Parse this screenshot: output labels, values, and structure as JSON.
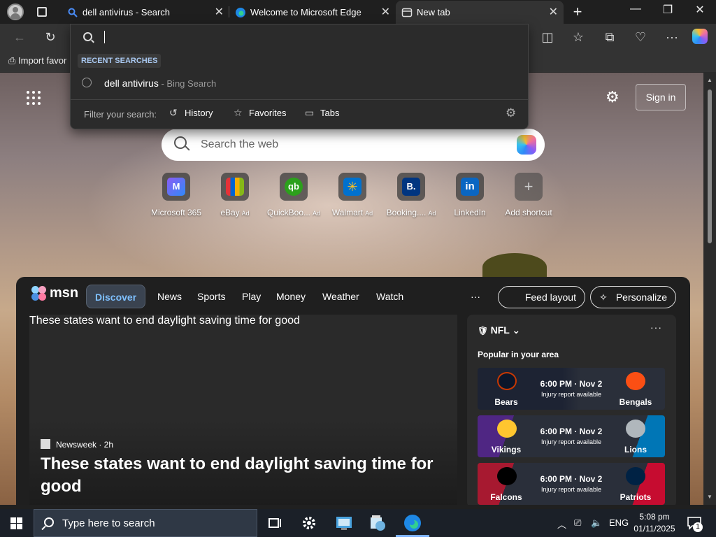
{
  "tabs": [
    {
      "title": "dell antivirus - Search"
    },
    {
      "title": "Welcome to Microsoft Edge"
    },
    {
      "title": "New tab"
    }
  ],
  "window_controls": {
    "new_tab": "+",
    "minimize": "—",
    "maximize": "❐",
    "close": "✕"
  },
  "favorites_bar": {
    "import_label": "Import favor"
  },
  "page": {
    "sign_in": "Sign in",
    "search_placeholder": "Search the web"
  },
  "shortcuts": [
    {
      "label": "Microsoft 365",
      "ad": "",
      "color": "#3a3a5a",
      "glyph": "M"
    },
    {
      "label": "eBay",
      "ad": "Ad",
      "color": "#1f1f1f",
      "glyph": "e"
    },
    {
      "label": "QuickBoo...",
      "ad": "Ad",
      "color": "#2ca01c",
      "glyph": "qb"
    },
    {
      "label": "Walmart",
      "ad": "Ad",
      "color": "#0071ce",
      "glyph": "✳"
    },
    {
      "label": "Booking....",
      "ad": "Ad",
      "color": "#003580",
      "glyph": "B."
    },
    {
      "label": "LinkedIn",
      "ad": "",
      "color": "#0a66c2",
      "glyph": "in"
    },
    {
      "label": "Add shortcut",
      "ad": "",
      "color": "transparent",
      "glyph": "+"
    }
  ],
  "msn": {
    "logo_text": "msn",
    "nav": [
      "Discover",
      "News",
      "Sports",
      "Play",
      "Money",
      "Weather",
      "Watch"
    ],
    "more": "···",
    "feed_layout": "Feed layout",
    "personalize": "Personalize",
    "hero": {
      "image_alt": "These states want to end daylight saving time for good",
      "source": "Newsweek · 2h",
      "headline": "These states want to end daylight saving time for good"
    },
    "sports": {
      "league": "NFL",
      "more": "···",
      "popular": "Popular in your area",
      "games": [
        {
          "home": "Bears",
          "away": "Bengals",
          "time": "6:00 PM · Nov 2",
          "note": "Injury report available",
          "bg": "#1e2436",
          "home_color": "#0b162a",
          "away_color": "#fb4f14"
        },
        {
          "home": "Vikings",
          "away": "Lions",
          "time": "6:00 PM · Nov 2",
          "note": "Injury report available",
          "bg": "#4f2683",
          "home_color": "#4f2683",
          "away_color": "#0076b6"
        },
        {
          "home": "Falcons",
          "away": "Patriots",
          "time": "6:00 PM · Nov 2",
          "note": "Injury report available",
          "bg": "#a71930",
          "home_color": "#a71930",
          "away_color": "#002244"
        }
      ]
    }
  },
  "dropdown": {
    "recent_label": "RECENT SEARCHES",
    "recent_query": "dell antivirus",
    "recent_sub": " - Bing Search",
    "filter_label": "Filter your search:",
    "filters": [
      "History",
      "Favorites",
      "Tabs"
    ]
  },
  "taskbar": {
    "search_placeholder": "Type here to search",
    "language": "ENG",
    "time": "5:08 pm",
    "date": "01/11/2025",
    "notification_count": "1"
  }
}
